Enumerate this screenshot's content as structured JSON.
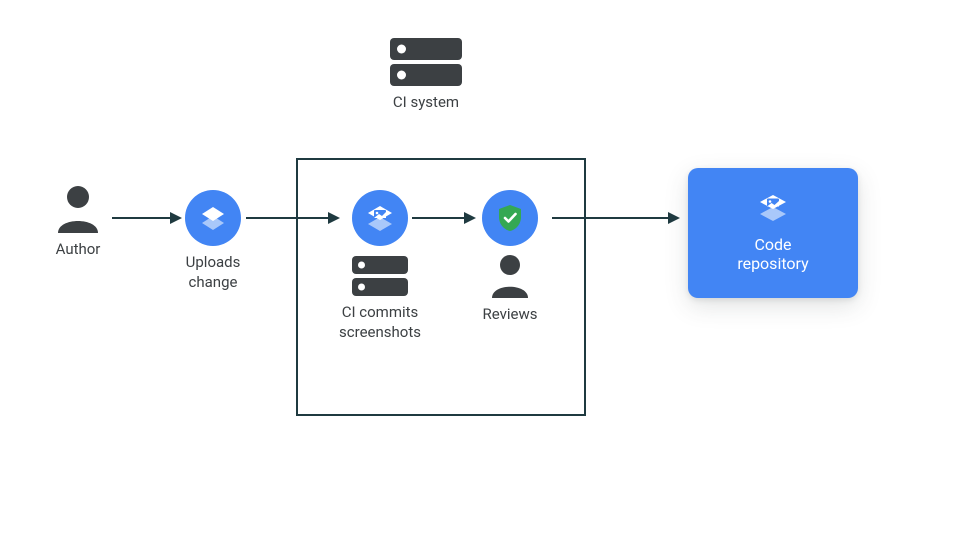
{
  "colors": {
    "accent": "#4285f4",
    "dark": "#3c4043",
    "outline": "#1f3a40",
    "shield": "#34a853"
  },
  "icons": {
    "author": "person-icon",
    "upload": "layers-icon",
    "ci_top": "server-icon",
    "ci_commit_top": "layers-picture-icon",
    "ci_commit_server": "server-icon",
    "review_badge": "shield-check-icon",
    "review_person": "person-icon",
    "repo": "layers-picture-icon"
  },
  "nodes": {
    "author": {
      "label": "Author"
    },
    "upload": {
      "label": "Uploads\nchange"
    },
    "ci_top": {
      "label": "CI system"
    },
    "ci_commit": {
      "label": "CI commits\nscreenshots"
    },
    "reviews": {
      "label": "Reviews"
    },
    "repo": {
      "label": "Code\nrepository"
    }
  },
  "flow": [
    "author",
    "upload",
    "ci_commit",
    "reviews",
    "repo"
  ]
}
